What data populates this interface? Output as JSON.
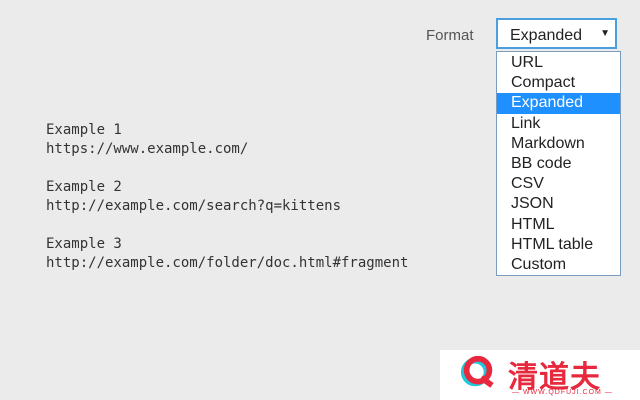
{
  "format": {
    "label": "Format",
    "selected_value": "Expanded",
    "arrow_icon": "triangle-down-icon",
    "options": [
      {
        "label": "URL"
      },
      {
        "label": "Compact"
      },
      {
        "label": "Expanded"
      },
      {
        "label": "Link"
      },
      {
        "label": "Markdown"
      },
      {
        "label": "BB code"
      },
      {
        "label": "CSV"
      },
      {
        "label": "JSON"
      },
      {
        "label": "HTML"
      },
      {
        "label": "HTML table"
      },
      {
        "label": "Custom"
      }
    ],
    "highlighted_index": 2
  },
  "examples": [
    {
      "title": "Example 1",
      "url": "https://www.example.com/"
    },
    {
      "title": "Example 2",
      "url": "http://example.com/search?q=kittens"
    },
    {
      "title": "Example 3",
      "url": "http://example.com/folder/doc.html#fragment"
    }
  ],
  "watermark": {
    "title": "清道夫",
    "subtitle": "— WWW.QDFUJI.COM —",
    "logo_icon": "q-logo-icon"
  },
  "colors": {
    "background": "#ebebeb",
    "select_border": "#4a9fe0",
    "highlight": "#1e90ff",
    "watermark_red": "#e8283d",
    "watermark_cyan": "#1ec8d8"
  }
}
